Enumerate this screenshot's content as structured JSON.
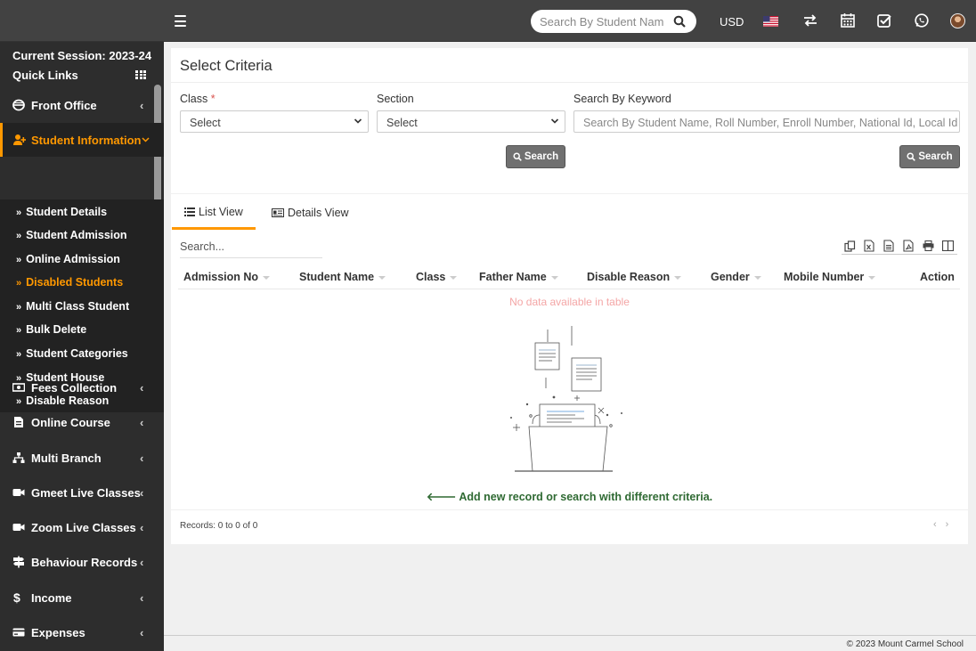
{
  "header": {
    "search_placeholder": "Search By Student Name",
    "currency": "USD",
    "icons": [
      "menu-icon",
      "search-icon",
      "us-flag-icon",
      "switch-icon",
      "calendar-icon",
      "task-check-icon",
      "whatsapp-icon",
      "user-avatar"
    ]
  },
  "sidebar": {
    "session": "Current Session: 2023-24",
    "quick_links": "Quick Links",
    "items": [
      {
        "label": "Front Office",
        "icon": "front-office-icon"
      },
      {
        "label": "Student Information",
        "icon": "user-plus-icon",
        "active": true
      },
      {
        "label": "Fees Collection",
        "icon": "money-icon"
      },
      {
        "label": "Online Course",
        "icon": "file-icon"
      },
      {
        "label": "Multi Branch",
        "icon": "sitemap-icon"
      },
      {
        "label": "Gmeet Live Classes",
        "icon": "video-icon"
      },
      {
        "label": "Zoom Live Classes",
        "icon": "video-icon"
      },
      {
        "label": "Behaviour Records",
        "icon": "signpost-icon"
      },
      {
        "label": "Income",
        "icon": "dollar-icon"
      },
      {
        "label": "Expenses",
        "icon": "credit-card-icon"
      }
    ],
    "sub_items": [
      {
        "label": "Student Details"
      },
      {
        "label": "Student Admission"
      },
      {
        "label": "Online Admission"
      },
      {
        "label": "Disabled Students",
        "active": true
      },
      {
        "label": "Multi Class Student"
      },
      {
        "label": "Bulk Delete"
      },
      {
        "label": "Student Categories"
      },
      {
        "label": "Student House"
      },
      {
        "label": "Disable Reason"
      }
    ],
    "accent": "#ff9800"
  },
  "criteria": {
    "title": "Select Criteria",
    "class_label": "Class",
    "required_mark": "*",
    "class_value": "Select",
    "section_label": "Section",
    "section_value": "Select",
    "keyword_label": "Search By Keyword",
    "keyword_placeholder": "Search By Student Name, Roll Number, Enroll Number, National Id, Local Id Etc.",
    "search_button": "Search",
    "search_button2": "Search"
  },
  "tabs": [
    {
      "label": "List View",
      "active": true
    },
    {
      "label": "Details View"
    }
  ],
  "table": {
    "search_placeholder": "Search...",
    "columns": [
      "Admission No",
      "Student Name",
      "Class",
      "Father Name",
      "Disable Reason",
      "Gender",
      "Mobile Number",
      "Action"
    ],
    "empty_text": "No data available in table",
    "add_new": "Add new record or search with different criteria.",
    "records": "Records: 0 to 0 of 0",
    "pager": [
      "‹",
      "›"
    ],
    "export_icons": [
      "copy-icon",
      "excel-icon",
      "csv-icon",
      "pdf-icon",
      "print-icon",
      "columns-icon"
    ]
  },
  "footer": {
    "copyright": "© 2023 Mount Carmel School"
  }
}
